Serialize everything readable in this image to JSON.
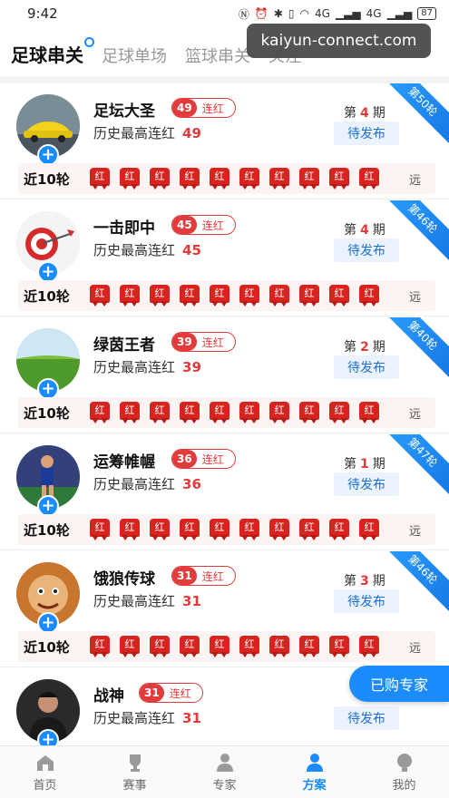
{
  "status": {
    "time": "9:42",
    "signal1": "4G",
    "signal2": "4G",
    "battery": "87"
  },
  "watermark": "kaiyun-connect.com",
  "tabs": [
    {
      "label": "足球串关",
      "active": true
    },
    {
      "label": "足球单场",
      "active": false
    },
    {
      "label": "篮球串关",
      "active": false
    },
    {
      "label": "关注",
      "active": false
    }
  ],
  "recent_label": "近10轮",
  "far_label": "远",
  "streak_suffix": "连红",
  "best_label": "历史最高连红",
  "pending_label": "待发布",
  "result_glyph": "红",
  "experts": [
    {
      "name": "足坛大圣",
      "streak": "49",
      "best": "49",
      "period_prefix": "第",
      "period": "4",
      "period_suffix": "期",
      "ribbon": "第50轮",
      "avatar": "car-avatar"
    },
    {
      "name": "一击即中",
      "streak": "45",
      "best": "45",
      "period_prefix": "第",
      "period": "4",
      "period_suffix": "期",
      "ribbon": "第46轮",
      "avatar": "dart-avatar"
    },
    {
      "name": "绿茵王者",
      "streak": "39",
      "best": "39",
      "period_prefix": "第",
      "period": "2",
      "period_suffix": "期",
      "ribbon": "第40轮",
      "avatar": "field-avatar"
    },
    {
      "name": "运筹帷幄",
      "streak": "36",
      "best": "36",
      "period_prefix": "第",
      "period": "1",
      "period_suffix": "期",
      "ribbon": "第47轮",
      "avatar": "player-avatar"
    },
    {
      "name": "饿狼传球",
      "streak": "31",
      "best": "31",
      "period_prefix": "第",
      "period": "3",
      "period_suffix": "期",
      "ribbon": "第46轮",
      "avatar": "cartoon-avatar"
    },
    {
      "name": "战神",
      "streak": "31",
      "best": "31",
      "period_prefix": "第",
      "period": "",
      "period_suffix": "",
      "ribbon": "",
      "avatar": "man-avatar"
    }
  ],
  "purchased_button": "已购专家",
  "nav": [
    {
      "label": "首页",
      "icon": "home-icon",
      "active": false
    },
    {
      "label": "赛事",
      "icon": "trophy-icon",
      "active": false
    },
    {
      "label": "专家",
      "icon": "expert-icon",
      "active": false
    },
    {
      "label": "方案",
      "icon": "plan-icon",
      "active": true
    },
    {
      "label": "我的",
      "icon": "profile-icon",
      "active": false
    }
  ],
  "colors": {
    "accent": "#1a8cff",
    "red": "#e23b3b"
  }
}
